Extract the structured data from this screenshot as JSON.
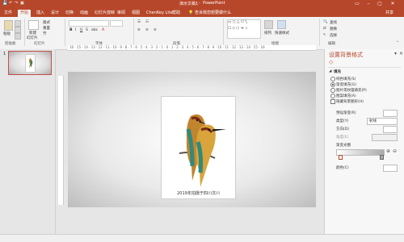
{
  "titlebar": {
    "doc_title": "演示文稿1",
    "app_name": "PowerPoint"
  },
  "tabs": [
    {
      "label": "文件"
    },
    {
      "label": "开始"
    },
    {
      "label": "插入"
    },
    {
      "label": "设计"
    },
    {
      "label": "切换"
    },
    {
      "label": "动画"
    },
    {
      "label": "幻灯片放映"
    },
    {
      "label": "审阅"
    },
    {
      "label": "视图"
    },
    {
      "label": "ChenKey Lite"
    },
    {
      "label": "帮助"
    }
  ],
  "tellme": "告诉我您想要做什么",
  "share": "共享",
  "ribbon": {
    "paste": "粘贴",
    "new_slide": "新建",
    "new_slide2": "幻灯片",
    "layout": "版式",
    "reset": "重置",
    "section": "节",
    "find": "查找",
    "replace": "替换",
    "select": "选择",
    "arrange": "排列",
    "quick_styles": "快速样式",
    "groups": {
      "clipboard": "剪贴板",
      "slides": "幻灯片",
      "font": "字体",
      "paragraph": "段落",
      "drawing": "绘图",
      "editing": "编辑"
    }
  },
  "thumbnail": {
    "number": "1"
  },
  "slide": {
    "caption": "2019年拍摄于四川汶川"
  },
  "ruler_marks": "16 · 15 · 14 · 13 · 12 · 11 · 10 · 9 · 8 · 7 · 6 · 5 · 4 · 3 · 2 · 1 · 0 · 1 · 2 · 3 · 4 · 5 · 6 · 7 · 8 · 9 · 10 · 11 · 12 · 13 · 14 · 15 · 16",
  "pane": {
    "title": "设置背景格式",
    "section": "填充",
    "fill_options": [
      {
        "label": "纯色填充(S)",
        "selected": false
      },
      {
        "label": "渐变填充(G)",
        "selected": true
      },
      {
        "label": "图片或纹理填充(P)",
        "selected": false
      },
      {
        "label": "图案填充(A)",
        "selected": false
      },
      {
        "label": "隐藏背景图形(H)",
        "selected": false
      }
    ],
    "preset": "预设渐变(R)",
    "type_label": "类型(Y)",
    "type_value": "射线",
    "direction_label": "方向(D)",
    "angle_label": "角度(E)",
    "stops_label": "渐变光圈",
    "color_label": "颜色(C)"
  },
  "colors": {
    "accent": "#b7472a",
    "ribbon_bg": "#f3f3f3"
  }
}
